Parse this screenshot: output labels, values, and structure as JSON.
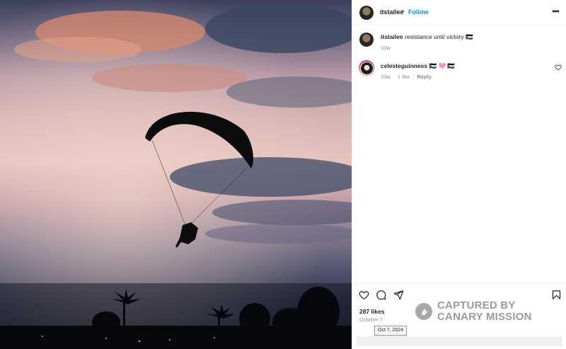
{
  "post": {
    "username": "itstailee",
    "separator": "•",
    "follow_label": "Follow",
    "more_icon": "more-horizontal-icon"
  },
  "caption": {
    "username": "itstailee",
    "text": " resistance until victory 🇵🇸",
    "time": "10w"
  },
  "comments": [
    {
      "username": "celesteguinness",
      "text": " 🇵🇸 🩷 🇵🇸",
      "time": "10w",
      "likes": "1 like",
      "reply_label": "Reply"
    }
  ],
  "actions": {
    "likes": "287 likes",
    "date": "October 7",
    "tooltip": "Oct 7, 2024",
    "icons": [
      "heart-icon",
      "comment-icon",
      "share-icon",
      "bookmark-icon"
    ]
  },
  "watermark": {
    "line1": "CAPTURED BY",
    "line2": "CANARY MISSION"
  },
  "colors": {
    "follow_blue": "#0095f6",
    "text": "#262626",
    "muted": "#8e8e8e"
  }
}
